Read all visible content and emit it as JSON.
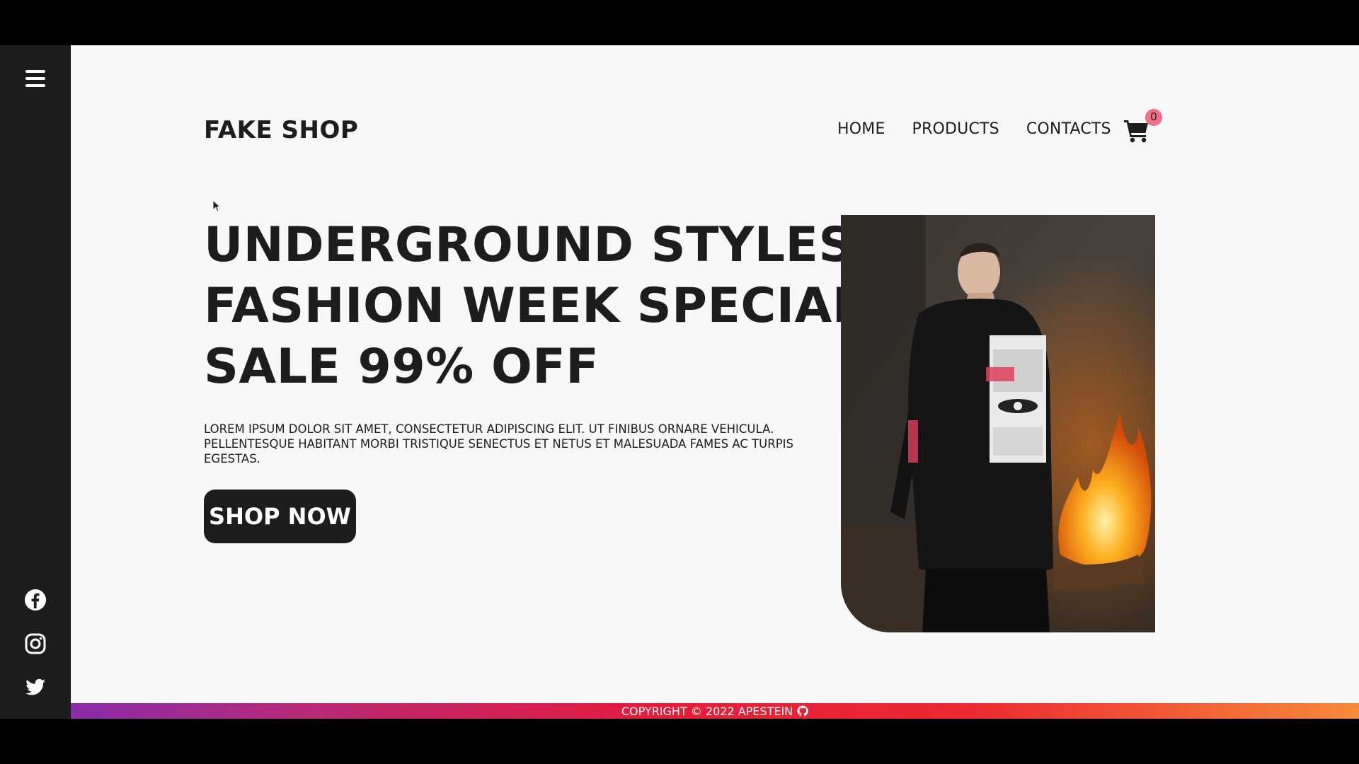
{
  "brand": {
    "name": "FAKE SHOP"
  },
  "nav": {
    "items": [
      {
        "label": "HOME"
      },
      {
        "label": "PRODUCTS"
      },
      {
        "label": "CONTACTS"
      }
    ]
  },
  "cart": {
    "count": "0",
    "icon": "cart-icon"
  },
  "sidebar": {
    "menu_icon": "hamburger-menu-icon",
    "social": [
      "facebook-icon",
      "instagram-icon",
      "twitter-icon"
    ]
  },
  "hero": {
    "title_lines": [
      "UNDERGROUND STYLES",
      "FASHION WEEK SPECIAL",
      "SALE 99% OFF"
    ],
    "description": "LOREM IPSUM DOLOR SIT AMET, CONSECTETUR ADIPISCING ELIT. UT FINIBUS ORNARE VEHICULA. PELLENTESQUE HABITANT MORBI TRISTIQUE SENECTUS ET NETUS ET MALESUADA FAMES AC TURPIS EGESTAS.",
    "cta_label": "SHOP NOW"
  },
  "footer": {
    "copyright": "COPYRIGHT © 2022 APESTEIN",
    "icon": "github-icon"
  },
  "colors": {
    "dark": "#1d1d1f",
    "page_bg": "#f8f8fa",
    "badge": "#f06f86",
    "footer_gradient": [
      "#8a2ca8",
      "#e51b3c",
      "#f78a3a"
    ]
  }
}
